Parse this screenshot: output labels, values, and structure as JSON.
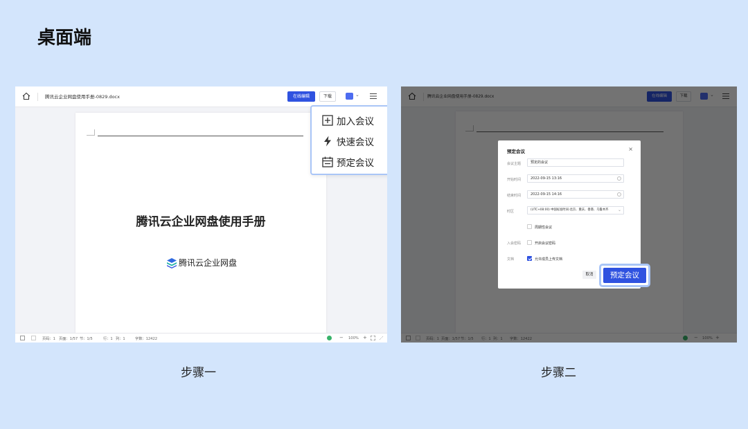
{
  "page": {
    "title": "桌面端"
  },
  "steps": [
    {
      "label": "步骤一"
    },
    {
      "label": "步骤二"
    }
  ],
  "editor": {
    "doc_name": "腾讯云企业网盘使用手册-0829.docx",
    "edit_button": "在线编辑",
    "download_button": "下载",
    "doc_title": "腾讯云企业网盘使用手册",
    "logo_text": "腾讯云企业网盘",
    "statusbar": {
      "pages": "页码：1",
      "page_of": "页面：1/57",
      "section": "节：1/5",
      "row": "行：1",
      "col": "列：1",
      "words": "字数：12422",
      "zoom": "100%",
      "minus": "−",
      "plus": "+"
    }
  },
  "dropdown": {
    "items": [
      {
        "label": "加入会议",
        "icon": "plus-square-icon"
      },
      {
        "label": "快速会议",
        "icon": "lightning-icon"
      },
      {
        "label": "预定会议",
        "icon": "calendar-icon"
      }
    ]
  },
  "modal": {
    "title": "预定会议",
    "close": "×",
    "fields": [
      {
        "label": "会议主题",
        "value": "预定的会议"
      },
      {
        "label": "开始时间",
        "value": "2022-09-15 13:16"
      },
      {
        "label": "结束时间",
        "value": "2022-09-15 14:16"
      },
      {
        "label": "时区",
        "value": "(UTC+08:00) 中国标准时间-北京、重庆、香港、乌鲁木齐"
      }
    ],
    "recurring": {
      "text": "周期性会议",
      "checked": false
    },
    "password": {
      "label": "入会密码",
      "text": "开启会议密码",
      "checked": false
    },
    "docs": {
      "label": "文档",
      "text": "允许成员上传文档",
      "checked": true
    },
    "cancel": "取消",
    "confirm": "预定会议"
  },
  "colors": {
    "background": "#d3e5fc",
    "accent": "#2f52e0",
    "highlight": "#a9c5f7"
  }
}
